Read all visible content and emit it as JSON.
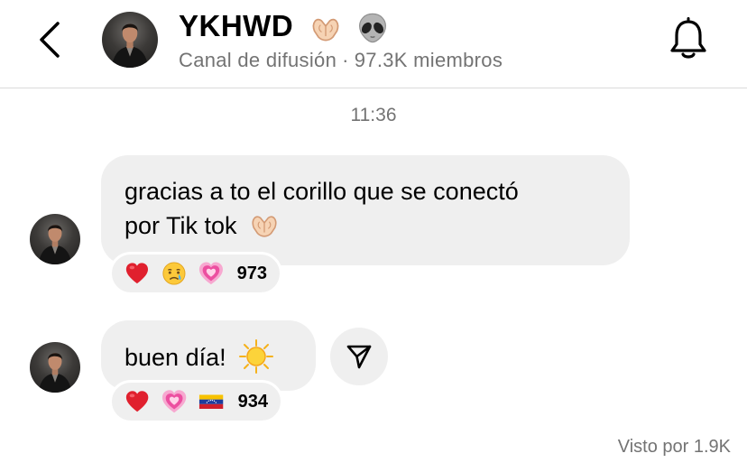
{
  "header": {
    "title": "YKHWD",
    "subtitle_type": "Canal de difusión",
    "separator": "·",
    "subtitle_members": "97.3K miembros"
  },
  "chat": {
    "timestamp": "11:36",
    "messages": [
      {
        "text_line1": "gracias a to el corillo que se conectó",
        "text_line2": "por Tik tok",
        "reactions": [
          "red-heart",
          "crying-face",
          "growing-heart"
        ],
        "reaction_count": "973"
      },
      {
        "text": "buen día!",
        "reactions": [
          "red-heart",
          "growing-heart",
          "venezuela-flag"
        ],
        "reaction_count": "934"
      }
    ],
    "seen_text": "Visto por 1.9K"
  },
  "icons": {
    "back": "chevron-left-icon",
    "bell": "bell-icon",
    "share": "paper-plane-icon",
    "header_emojis": [
      "heart-hands-emoji",
      "alien-emoji"
    ],
    "message_emojis": [
      "heart-hands-emoji",
      "sun-emoji"
    ]
  },
  "colors": {
    "bubble": "#efefef",
    "secondary_text": "#737373",
    "divider": "#dbdbdb"
  }
}
